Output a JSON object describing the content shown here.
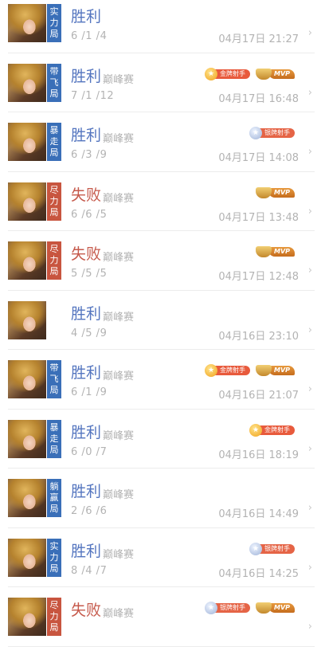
{
  "matches": [
    {
      "tag": "实力局",
      "tag_color": "#3a6fb8",
      "result": "胜利",
      "outcome": "win",
      "mode": "",
      "kda": "6 /1 /4",
      "time": "04月17日 21:27",
      "badges": [],
      "icon": "hero-avatar"
    },
    {
      "tag": "带飞局",
      "tag_color": "#3a6fb8",
      "result": "胜利",
      "outcome": "win",
      "mode": "巅峰赛",
      "kda": "7 /1 /12",
      "time": "04月17日 16:48",
      "badges": [
        {
          "type": "gold",
          "label": "金牌射手"
        },
        {
          "type": "mvp",
          "label": "MVP"
        }
      ],
      "icon": "hero-avatar"
    },
    {
      "tag": "暴走局",
      "tag_color": "#3a6fb8",
      "result": "胜利",
      "outcome": "win",
      "mode": "巅峰赛",
      "kda": "6 /3 /9",
      "time": "04月17日 14:08",
      "badges": [
        {
          "type": "silver",
          "label": "银牌射手"
        }
      ],
      "icon": "hero-avatar"
    },
    {
      "tag": "尽力局",
      "tag_color": "#c8553f",
      "result": "失败",
      "outcome": "lose",
      "mode": "巅峰赛",
      "kda": "6 /6 /5",
      "time": "04月17日 13:48",
      "badges": [
        {
          "type": "mvp",
          "label": "MVP"
        }
      ],
      "icon": "hero-avatar"
    },
    {
      "tag": "尽力局",
      "tag_color": "#c8553f",
      "result": "失败",
      "outcome": "lose",
      "mode": "巅峰赛",
      "kda": "5 /5 /5",
      "time": "04月17日 12:48",
      "badges": [
        {
          "type": "mvp",
          "label": "MVP"
        }
      ],
      "icon": "hero-avatar"
    },
    {
      "tag": "",
      "tag_color": "",
      "result": "胜利",
      "outcome": "win",
      "mode": "巅峰赛",
      "kda": "4 /5 /9",
      "time": "04月16日 23:10",
      "badges": [],
      "icon": "hero-avatar"
    },
    {
      "tag": "带飞局",
      "tag_color": "#3a6fb8",
      "result": "胜利",
      "outcome": "win",
      "mode": "巅峰赛",
      "kda": "6 /1 /9",
      "time": "04月16日 21:07",
      "badges": [
        {
          "type": "gold",
          "label": "金牌射手"
        },
        {
          "type": "mvp",
          "label": "MVP"
        }
      ],
      "icon": "hero-avatar"
    },
    {
      "tag": "暴走局",
      "tag_color": "#3a6fb8",
      "result": "胜利",
      "outcome": "win",
      "mode": "巅峰赛",
      "kda": "6 /0 /7",
      "time": "04月16日 18:19",
      "badges": [
        {
          "type": "gold",
          "label": "金牌射手"
        }
      ],
      "icon": "hero-avatar"
    },
    {
      "tag": "躺赢局",
      "tag_color": "#3a6fb8",
      "result": "胜利",
      "outcome": "win",
      "mode": "巅峰赛",
      "kda": "2 /6 /6",
      "time": "04月16日 14:49",
      "badges": [],
      "icon": "hero-avatar"
    },
    {
      "tag": "实力局",
      "tag_color": "#3a6fb8",
      "result": "胜利",
      "outcome": "win",
      "mode": "巅峰赛",
      "kda": "8 /4 /7",
      "time": "04月16日 14:25",
      "badges": [
        {
          "type": "silver",
          "label": "银牌射手"
        }
      ],
      "icon": "hero-avatar"
    },
    {
      "tag": "尽力局",
      "tag_color": "#c8553f",
      "result": "失败",
      "outcome": "lose",
      "mode": "巅峰赛",
      "kda": "",
      "time": "",
      "badges": [
        {
          "type": "silver",
          "label": "银牌射手"
        },
        {
          "type": "mvp",
          "label": "MVP"
        }
      ],
      "icon": "hero-avatar"
    }
  ],
  "arrow_glyph": "›"
}
